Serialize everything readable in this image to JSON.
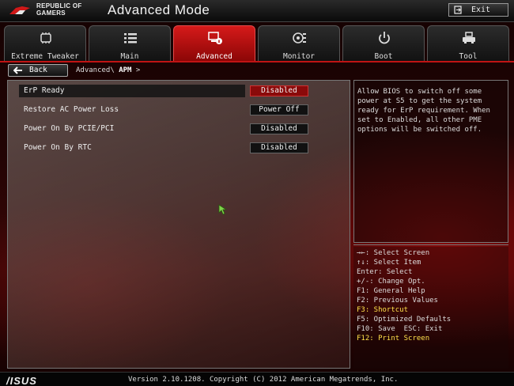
{
  "header": {
    "brand_line1": "REPUBLIC OF",
    "brand_line2": "GAMERS",
    "mode_title": "Advanced Mode",
    "exit_label": "Exit"
  },
  "tabs": [
    {
      "label": "Extreme Tweaker",
      "icon": "tweaker-icon",
      "active": false
    },
    {
      "label": "Main",
      "icon": "list-icon",
      "active": false
    },
    {
      "label": "Advanced",
      "icon": "advanced-icon",
      "active": true
    },
    {
      "label": "Monitor",
      "icon": "monitor-icon",
      "active": false
    },
    {
      "label": "Boot",
      "icon": "power-icon",
      "active": false
    },
    {
      "label": "Tool",
      "icon": "tool-icon",
      "active": false
    }
  ],
  "nav": {
    "back_label": "Back",
    "breadcrumb_parent": "Advanced\\",
    "breadcrumb_current": "APM",
    "breadcrumb_arrow": ">"
  },
  "items": [
    {
      "label": "ErP Ready",
      "value": "Disabled",
      "selected": true
    },
    {
      "label": "Restore AC Power Loss",
      "value": "Power Off",
      "selected": false
    },
    {
      "label": "Power On By PCIE/PCI",
      "value": "Disabled",
      "selected": false
    },
    {
      "label": "Power On By RTC",
      "value": "Disabled",
      "selected": false
    }
  ],
  "help": {
    "text": "Allow BIOS to switch off some power at S5 to get the system ready for ErP requirement. When set to Enabled, all other PME options will be switched off."
  },
  "keys": [
    {
      "text": "→←: Select Screen",
      "hot": false
    },
    {
      "text": "↑↓: Select Item",
      "hot": false
    },
    {
      "text": "Enter: Select",
      "hot": false
    },
    {
      "text": "+/-: Change Opt.",
      "hot": false
    },
    {
      "text": "F1: General Help",
      "hot": false
    },
    {
      "text": "F2: Previous Values",
      "hot": false
    },
    {
      "text": "F3: Shortcut",
      "hot": true
    },
    {
      "text": "F5: Optimized Defaults",
      "hot": false
    },
    {
      "text": "F10: Save  ESC: Exit",
      "hot": false
    },
    {
      "text": "F12: Print Screen",
      "hot": true
    }
  ],
  "footer": {
    "logo": "/ISUS",
    "version": "Version 2.10.1208. Copyright (C) 2012 American Megatrends, Inc."
  },
  "colors": {
    "accent": "#c01414",
    "hotkey": "#ffe14a"
  }
}
